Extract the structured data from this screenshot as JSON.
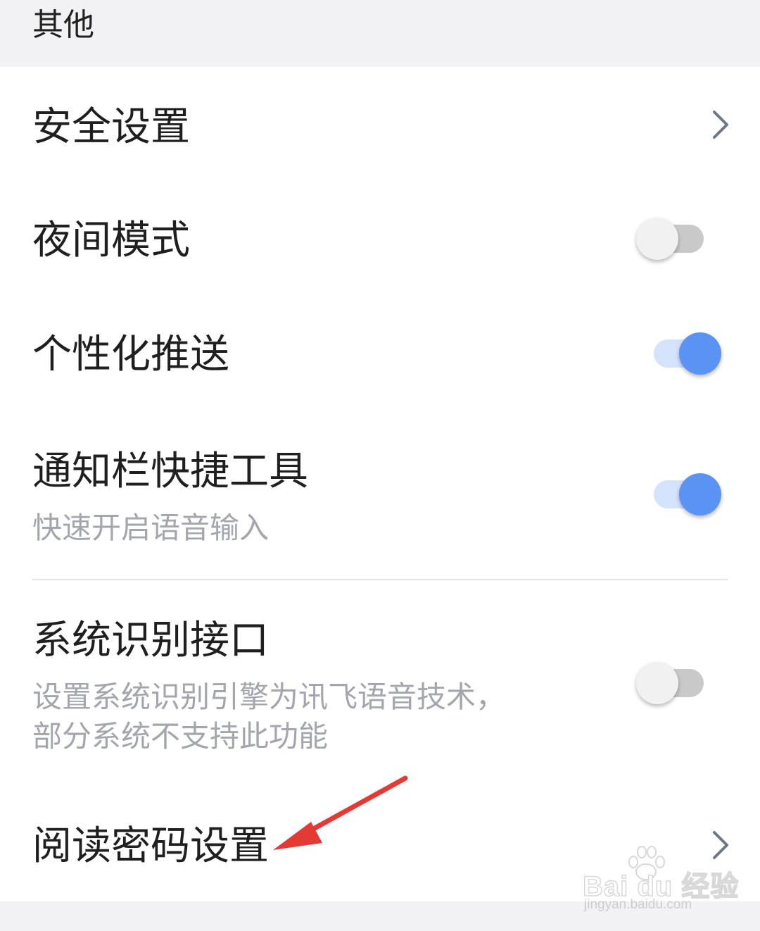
{
  "section": {
    "title": "其他"
  },
  "settings": {
    "security": {
      "title": "安全设置"
    },
    "night_mode": {
      "title": "夜间模式",
      "enabled": false
    },
    "personalized_push": {
      "title": "个性化推送",
      "enabled": true
    },
    "notification_tools": {
      "title": "通知栏快捷工具",
      "subtitle": "快速开启语音输入",
      "enabled": true
    },
    "system_recognition": {
      "title": "系统识别接口",
      "subtitle_line1": "设置系统识别引擎为讯飞语音技术，",
      "subtitle_line2": "部分系统不支持此功能",
      "enabled": false
    },
    "reading_password": {
      "title": "阅读密码设置"
    }
  },
  "colors": {
    "toggle_on": "#5b93f4",
    "toggle_on_track": "#d4e2fc",
    "toggle_off_track": "#c9c9c9",
    "annotation_arrow": "#e53935"
  },
  "icons": {
    "chevron": "chevron-right-icon",
    "annotation": "red-arrow-icon"
  },
  "watermark": {
    "brand": "Bai du 经验",
    "url": "jingyan.baidu.com"
  }
}
